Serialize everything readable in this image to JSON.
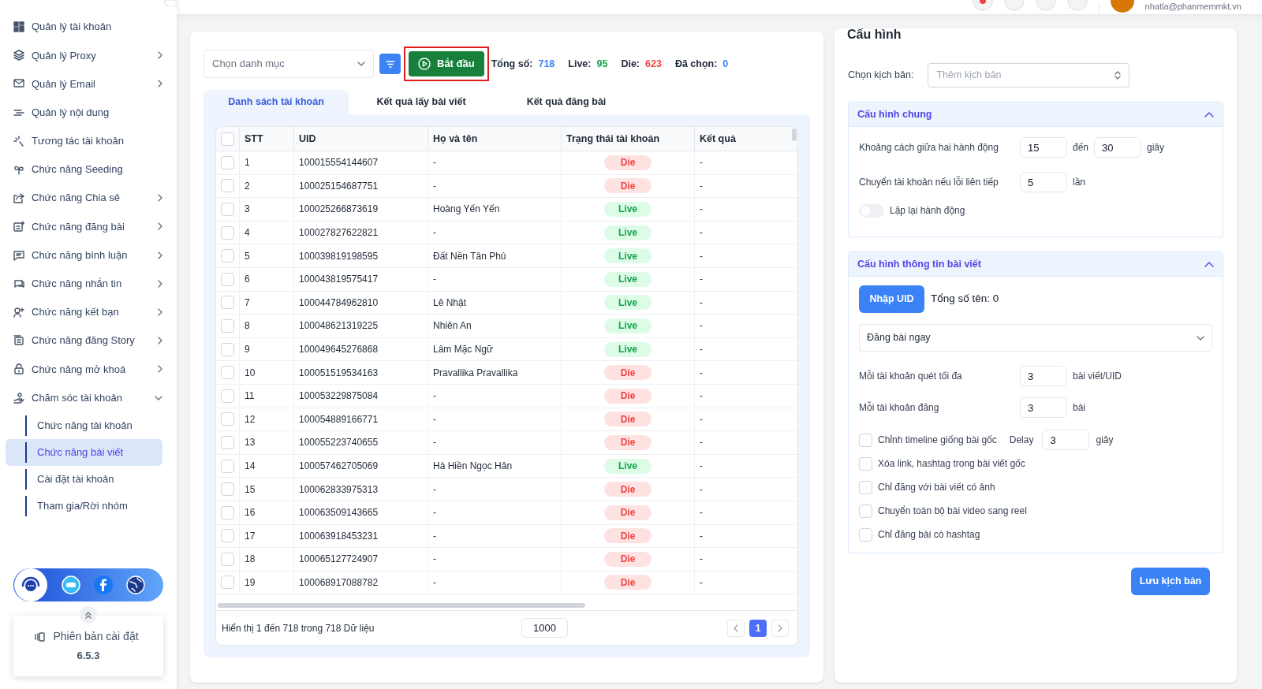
{
  "header": {
    "email": "nhatla@phanmemmkt.vn"
  },
  "sidebar": {
    "items": [
      {
        "label": "Quản lý tài khoản",
        "expandable": false
      },
      {
        "label": "Quản lý Proxy",
        "expandable": true,
        "expanded": false
      },
      {
        "label": "Quản lý Email",
        "expandable": true,
        "expanded": false
      },
      {
        "label": "Quản lý nội dung",
        "expandable": false
      },
      {
        "label": "Tương tác tài khoản",
        "expandable": false
      },
      {
        "label": "Chức năng Seeding",
        "expandable": false
      },
      {
        "label": "Chức năng Chia sẻ",
        "expandable": true,
        "expanded": false
      },
      {
        "label": "Chức năng đăng bài",
        "expandable": true,
        "expanded": false
      },
      {
        "label": "Chức năng bình luận",
        "expandable": true,
        "expanded": false
      },
      {
        "label": "Chức năng nhắn tin",
        "expandable": true,
        "expanded": false
      },
      {
        "label": "Chức năng kết bạn",
        "expandable": true,
        "expanded": false
      },
      {
        "label": "Chức năng đăng Story",
        "expandable": true,
        "expanded": false
      },
      {
        "label": "Chức năng mở khoá",
        "expandable": true,
        "expanded": false
      },
      {
        "label": "Chăm sóc tài khoản",
        "expandable": true,
        "expanded": true,
        "children": [
          {
            "label": "Chức năng tài khoản",
            "selected": false
          },
          {
            "label": "Chức năng bài viết",
            "selected": true
          },
          {
            "label": "Cài đặt tài khoản",
            "selected": false
          },
          {
            "label": "Tham gia/Rời nhóm",
            "selected": false
          }
        ]
      }
    ],
    "version": {
      "label": "Phiên bản cài đặt",
      "number": "6.5.3"
    }
  },
  "toolbar": {
    "category_placeholder": "Chọn danh mục",
    "start_button": "Bắt đầu",
    "stats": [
      {
        "label": "Tổng số:",
        "value": "718",
        "color": "#3b82f6"
      },
      {
        "label": "Live:",
        "value": "95",
        "color": "#16a34a"
      },
      {
        "label": "Die:",
        "value": "623",
        "color": "#ef4444"
      },
      {
        "label": "Đã chọn:",
        "value": "0",
        "color": "#3b82f6"
      }
    ]
  },
  "tabs": [
    {
      "label": "Danh sách tài khoản",
      "selected": true
    },
    {
      "label": "Kết quả lấy bài viết",
      "selected": false
    },
    {
      "label": "Kết quả đăng bài",
      "selected": false
    }
  ],
  "table": {
    "all_checked": false,
    "columns": [
      "STT",
      "UID",
      "Họ và tên",
      "Trạng thái tài khoản",
      "Kết quả"
    ],
    "rows": [
      {
        "checked": false,
        "stt": "1",
        "uid": "100015554144607",
        "name": "-",
        "status": "Die",
        "alive": false,
        "result": "-"
      },
      {
        "checked": false,
        "stt": "2",
        "uid": "100025154687751",
        "name": "-",
        "status": "Die",
        "alive": false,
        "result": "-"
      },
      {
        "checked": false,
        "stt": "3",
        "uid": "100025266873619",
        "name": "Hoàng Yến Yến",
        "status": "Live",
        "alive": true,
        "result": "-"
      },
      {
        "checked": false,
        "stt": "4",
        "uid": "100027827622821",
        "name": "-",
        "status": "Live",
        "alive": true,
        "result": "-"
      },
      {
        "checked": false,
        "stt": "5",
        "uid": "100039819198595",
        "name": "Đất Nền Tân Phú",
        "status": "Live",
        "alive": true,
        "result": "-"
      },
      {
        "checked": false,
        "stt": "6",
        "uid": "100043819575417",
        "name": "-",
        "status": "Live",
        "alive": true,
        "result": "-"
      },
      {
        "checked": false,
        "stt": "7",
        "uid": "100044784962810",
        "name": "Lê Nhật",
        "status": "Live",
        "alive": true,
        "result": "-"
      },
      {
        "checked": false,
        "stt": "8",
        "uid": "100048621319225",
        "name": "Nhiên An",
        "status": "Live",
        "alive": true,
        "result": "-"
      },
      {
        "checked": false,
        "stt": "9",
        "uid": "100049645276868",
        "name": "Lâm Mặc Ngữ",
        "status": "Live",
        "alive": true,
        "result": "-"
      },
      {
        "checked": false,
        "stt": "10",
        "uid": "100051519534163",
        "name": "Pravallika Pravallika",
        "status": "Die",
        "alive": false,
        "result": "-"
      },
      {
        "checked": false,
        "stt": "11",
        "uid": "100053229875084",
        "name": "-",
        "status": "Die",
        "alive": false,
        "result": "-"
      },
      {
        "checked": false,
        "stt": "12",
        "uid": "100054889166771",
        "name": "-",
        "status": "Die",
        "alive": false,
        "result": "-"
      },
      {
        "checked": false,
        "stt": "13",
        "uid": "100055223740655",
        "name": "-",
        "status": "Die",
        "alive": false,
        "result": "-"
      },
      {
        "checked": false,
        "stt": "14",
        "uid": "100057462705069",
        "name": "Hà Hiền Ngọc Hân",
        "status": "Live",
        "alive": true,
        "result": "-"
      },
      {
        "checked": false,
        "stt": "15",
        "uid": "100062833975313",
        "name": "-",
        "status": "Die",
        "alive": false,
        "result": "-"
      },
      {
        "checked": false,
        "stt": "16",
        "uid": "100063509143665",
        "name": "-",
        "status": "Die",
        "alive": false,
        "result": "-"
      },
      {
        "checked": false,
        "stt": "17",
        "uid": "100063918453231",
        "name": "-",
        "status": "Die",
        "alive": false,
        "result": "-"
      },
      {
        "checked": false,
        "stt": "18",
        "uid": "100065127724907",
        "name": "-",
        "status": "Die",
        "alive": false,
        "result": "-"
      },
      {
        "checked": false,
        "stt": "19",
        "uid": "100068917088782",
        "name": "-",
        "status": "Die",
        "alive": false,
        "result": "-"
      }
    ],
    "footer": "Hiển thị 1 đến 718 trong 718 Dữ liệu",
    "page_size": "1000",
    "pages": [
      {
        "label": "1",
        "selected": true
      }
    ]
  },
  "config": {
    "title": "Cấu hình",
    "script_label": "Chọn kịch bản:",
    "script_placeholder": "Thêm kịch bản",
    "general": {
      "title": "Cấu hình chung",
      "expanded": true,
      "interval": {
        "label": "Khoảng cách giữa hai hành động",
        "from": "15",
        "to_word": "đến",
        "to": "30",
        "unit": "giây"
      },
      "switch_account": {
        "label": "Chuyển tài khoản nếu lỗi liên tiếp",
        "value": "5",
        "unit": "lần"
      },
      "repeat": {
        "label": "Lặp lại hành động",
        "on": false
      }
    },
    "post": {
      "title": "Cấu hình thông tin bài viết",
      "expanded": true,
      "import_button": "Nhập UID",
      "total": "Tổng số tên: 0",
      "mode": "Đăng bài ngay",
      "fields": [
        {
          "label": "Mỗi tài khoản quét tối đa",
          "value": "3",
          "unit": "bài viết/UID"
        },
        {
          "label": "Mỗi tài khoản đăng",
          "value": "3",
          "unit": "bài"
        }
      ],
      "options": [
        {
          "label": "Chỉnh timeline giống bài gốc",
          "checked": false,
          "delay_label": "Delay",
          "delay": "3",
          "delay_unit": "giây"
        },
        {
          "label": "Xóa link, hashtag trong bài viết gốc",
          "checked": false
        },
        {
          "label": "Chỉ đăng với bài viết có ảnh",
          "checked": false
        },
        {
          "label": "Chuyển toàn bộ bài video sang reel",
          "checked": false
        },
        {
          "label": "Chỉ đăng bài có hashtag",
          "checked": false
        }
      ]
    },
    "save_button": "Lưu kịch bản"
  }
}
